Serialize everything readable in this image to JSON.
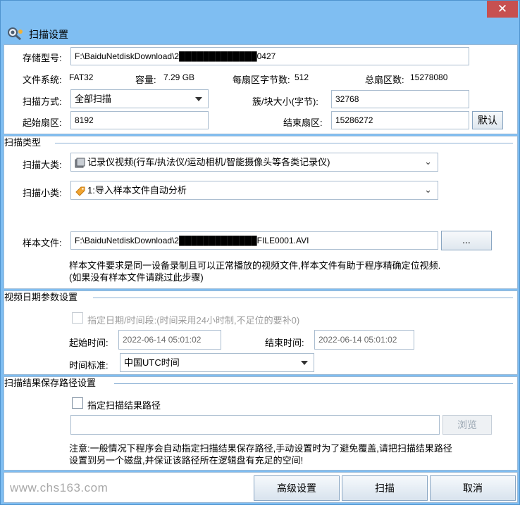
{
  "window": {
    "title": "扫描设置",
    "close_glyph": "✕"
  },
  "device": {
    "storage_label": "存储型号:",
    "storage_value": "F:\\BaiduNetdiskDownload\\2█████████████0427",
    "fs_label": "文件系统:",
    "fs_value": "FAT32",
    "capacity_label": "容量:",
    "capacity_value": "7.29 GB",
    "bytes_per_sector_label": "每扇区字节数:",
    "bytes_per_sector_value": "512",
    "total_sectors_label": "总扇区数:",
    "total_sectors_value": "15278080",
    "scan_mode_label": "扫描方式:",
    "scan_mode_value": "全部扫描",
    "cluster_label": "簇/块大小(字节):",
    "cluster_value": "32768",
    "start_sector_label": "起始扇区:",
    "start_sector_value": "8192",
    "end_sector_label": "结束扇区:",
    "end_sector_value": "15286272",
    "default_button": "默认"
  },
  "scan_type": {
    "group_title": "扫描类型",
    "major_label": "扫描大类:",
    "major_value": "记录仪视频(行车/执法仪/运动相机/智能摄像头等各类记录仪)",
    "minor_label": "扫描小类:",
    "minor_value": "1:导入样本文件自动分析",
    "sample_label": "样本文件:",
    "sample_value": "F:\\BaiduNetdiskDownload\\2█████████████FILE0001.AVI",
    "browse_button": "...",
    "note": "样本文件要求是同一设备录制且可以正常播放的视频文件,样本文件有助于程序精确定位视频.(如果没有样本文件请跳过此步骤)"
  },
  "date_params": {
    "group_title": "视频日期参数设置",
    "checkbox_label": "指定日期/时间段:(时间采用24小时制,不足位的要补0)",
    "start_label": "起始时间:",
    "start_value": "2022-06-14 05:01:02",
    "end_label": "结束时间:",
    "end_value": "2022-06-14 05:01:02",
    "tz_label": "时间标准:",
    "tz_value": "中国UTC时间"
  },
  "save_path": {
    "group_title": "扫描结果保存路径设置",
    "checkbox_label": "指定扫描结果路径",
    "path_value": "",
    "browse_button": "浏览",
    "note": "注意:一般情况下程序会自动指定扫描结果保存路径,手动设置时为了避免覆盖,请把扫描结果路径设置到另一个磁盘,并保证该路径所在逻辑盘有充足的空间!"
  },
  "footer": {
    "watermark": "www.chs163.com",
    "advanced_button": "高级设置",
    "scan_button": "扫描",
    "cancel_button": "取消"
  },
  "icons": [
    "close-icon",
    "scan-settings-icon",
    "dropdown-arrow-icon",
    "chevron-down-icon",
    "recorder-icon",
    "tag-icon"
  ],
  "colors": {
    "frame": "#7fbef2",
    "close": "#c75050",
    "group_line": "#8db2d6"
  }
}
